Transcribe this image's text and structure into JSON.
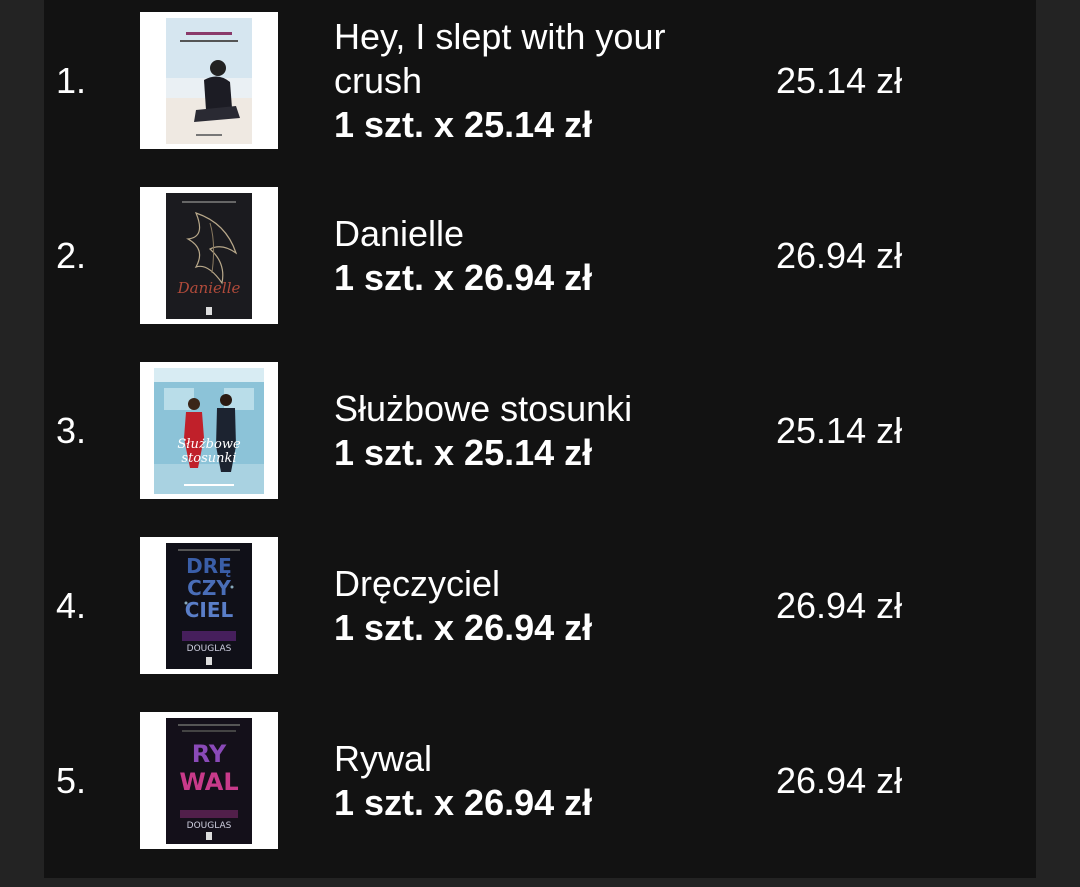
{
  "colors": {
    "background": "#121212",
    "outer": "#232323",
    "text": "#ffffff"
  },
  "order_items": [
    {
      "index": "1.",
      "title": "Hey, I slept with your crush",
      "qty_line": "1 szt. x 25.14 zł",
      "total": "25.14 zł",
      "cover_icon": "book-cover-beach"
    },
    {
      "index": "2.",
      "title": "Danielle",
      "qty_line": "1 szt. x 26.94 zł",
      "total": "26.94 zł",
      "cover_icon": "book-cover-dark-flower"
    },
    {
      "index": "3.",
      "title": "Służbowe stosunki",
      "qty_line": "1 szt. x 25.14 zł",
      "total": "25.14 zł",
      "cover_icon": "book-cover-office-couple"
    },
    {
      "index": "4.",
      "title": "Dręczyciel",
      "qty_line": "1 szt. x 26.94 zł",
      "total": "26.94 zł",
      "cover_icon": "book-cover-dark-blue"
    },
    {
      "index": "5.",
      "title": "Rywal",
      "qty_line": "1 szt. x 26.94 zł",
      "total": "26.94 zł",
      "cover_icon": "book-cover-dark-pink"
    }
  ]
}
